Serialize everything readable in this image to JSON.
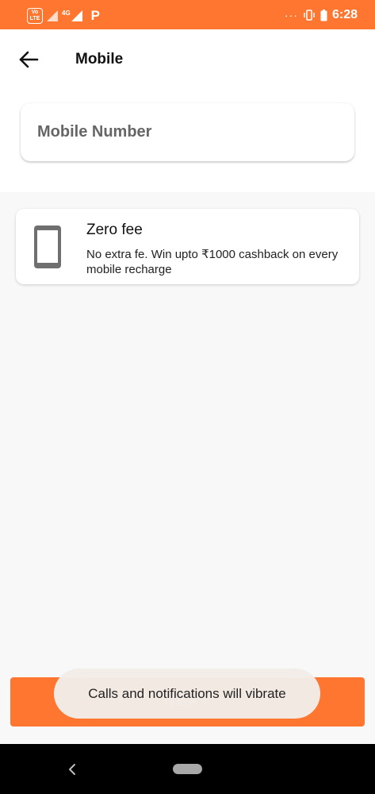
{
  "status_bar": {
    "volte_top": "Vo",
    "volte_bottom": "LTE",
    "network": "4G",
    "app_indicator": "P",
    "dots": "···",
    "time": "6:28",
    "icons": [
      "volte-icon",
      "signal-icon",
      "signal-4g-icon",
      "app-p-icon",
      "more-dots-icon",
      "vibrate-icon",
      "battery-icon"
    ]
  },
  "header": {
    "title": "Mobile",
    "back_icon": "arrow-left-icon"
  },
  "mobile_input": {
    "placeholder": "Mobile Number",
    "value": ""
  },
  "fee_card": {
    "icon": "phone-icon",
    "title": "Zero fee",
    "description": "No extra fe. Win upto ₹1000 cashback on every mobile recharge"
  },
  "next_button": {
    "label": "NEXT"
  },
  "toast": {
    "message": "Calls and notifications will vibrate"
  },
  "nav_bar": {
    "back_icon": "nav-back-icon",
    "home_icon": "nav-home-pill-icon"
  },
  "colors": {
    "accent": "#ff7630",
    "background": "#f8f8f8",
    "card": "#ffffff",
    "nav_bar": "#000000"
  }
}
